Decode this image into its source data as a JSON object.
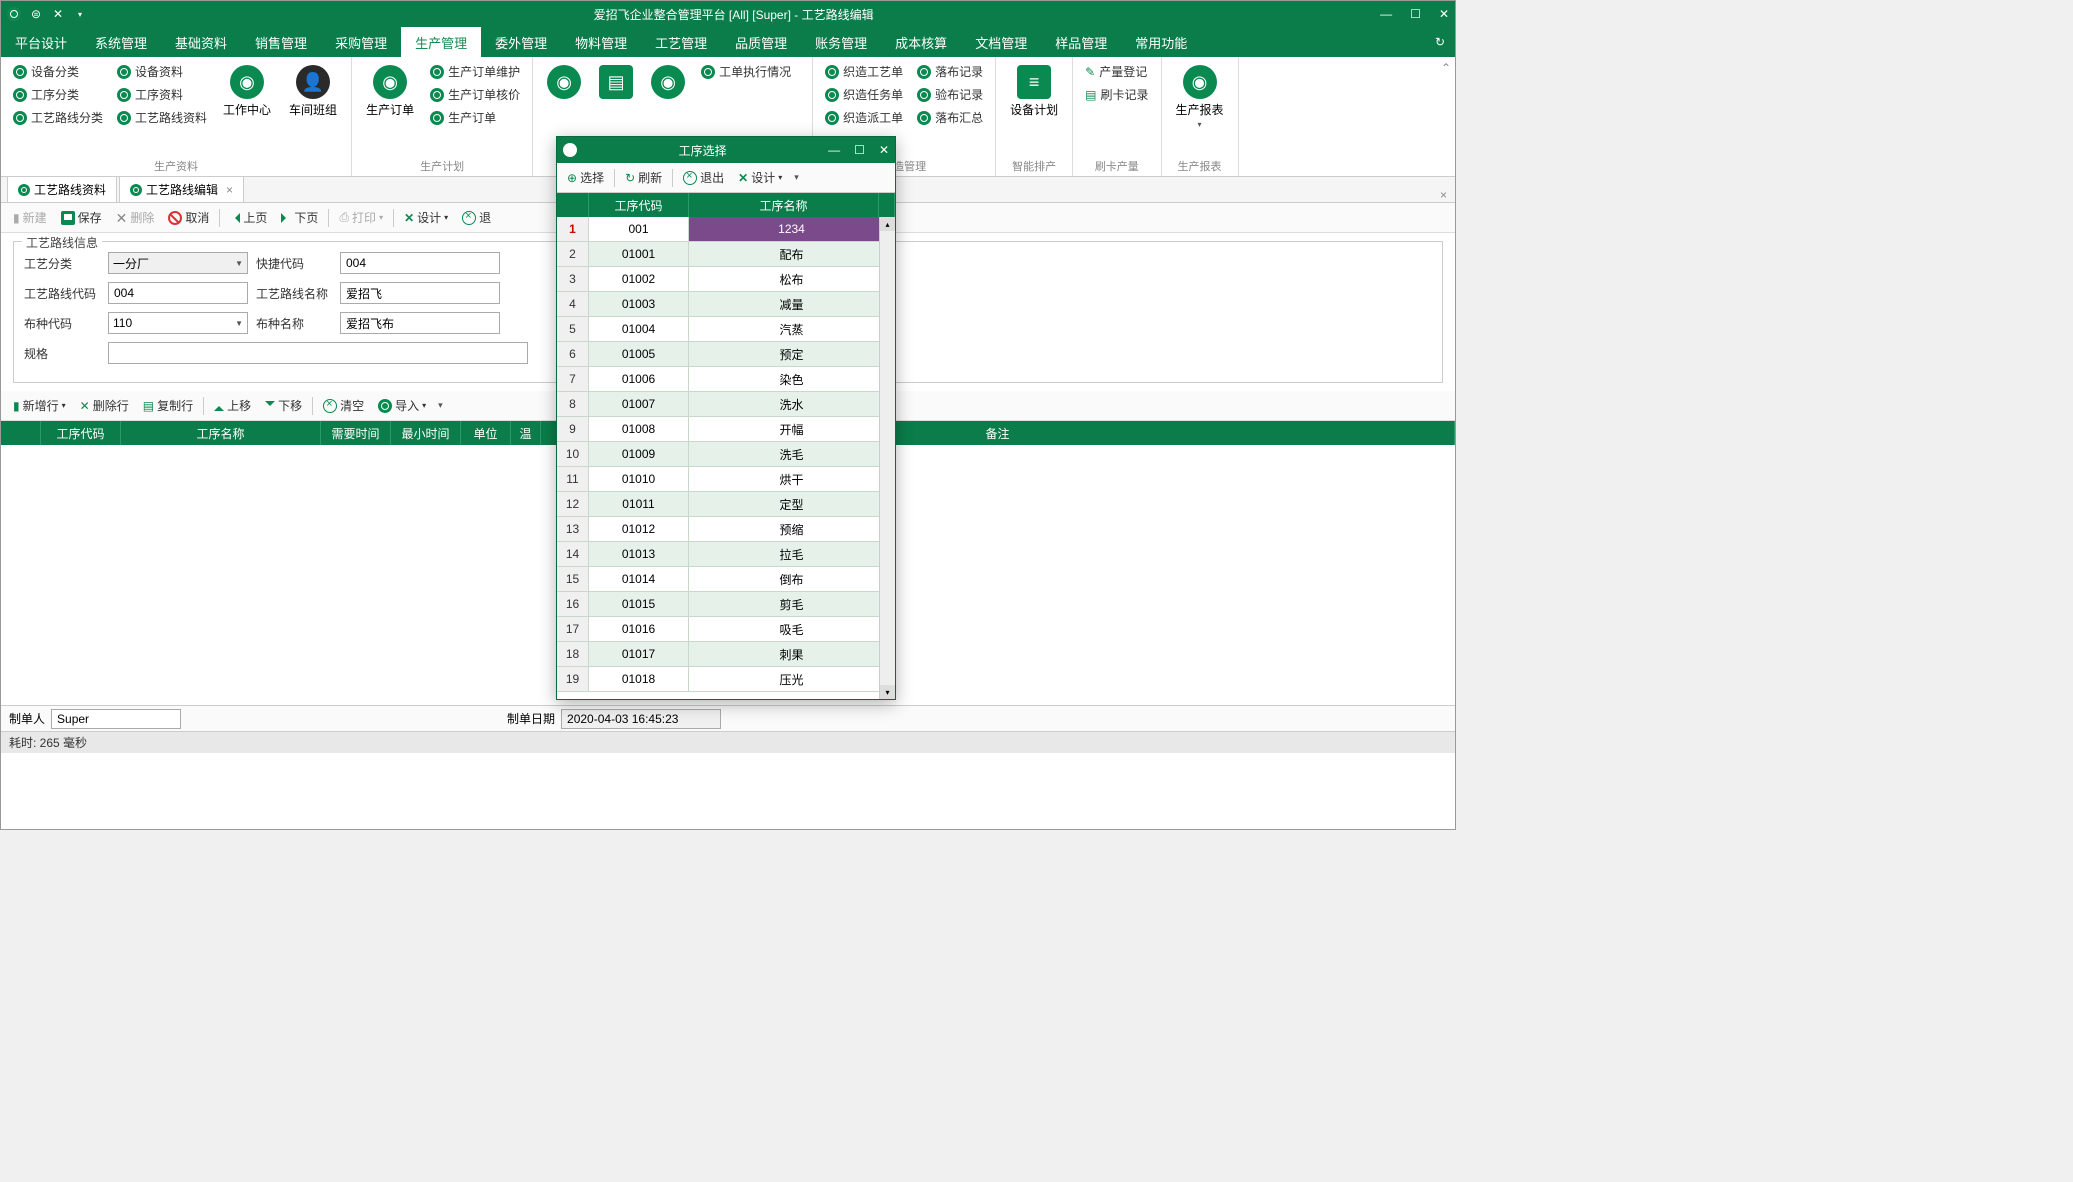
{
  "titlebar": {
    "title": "爱招飞企业整合管理平台 [All] [Super] - 工艺路线编辑"
  },
  "menu": [
    "平台设计",
    "系统管理",
    "基础资料",
    "销售管理",
    "采购管理",
    "生产管理",
    "委外管理",
    "物料管理",
    "工艺管理",
    "品质管理",
    "账务管理",
    "成本核算",
    "文档管理",
    "样品管理",
    "常用功能"
  ],
  "menu_active": 5,
  "ribbon": {
    "g1_label": "生产资料",
    "g1_col1": [
      "设备分类",
      "工序分类",
      "工艺路线分类"
    ],
    "g1_col2": [
      "设备资料",
      "工序资料",
      "工艺路线资料"
    ],
    "g1_big1": "工作中心",
    "g1_big2": "车间班组",
    "g2_label": "生产计划",
    "g2_big": "生产订单",
    "g2_col": [
      "生产订单维护",
      "生产订单核价",
      "生产订单"
    ],
    "g3_item": "工单执行情况",
    "g4_label": "织造管理",
    "g4_col1": [
      "织造工艺单",
      "织造任务单",
      "织造派工单"
    ],
    "g4_col2": [
      "落布记录",
      "验布记录",
      "落布汇总"
    ],
    "g5_label": "智能排产",
    "g5_big": "设备计划",
    "g6_label": "刷卡产量",
    "g6_item1": "产量登记",
    "g6_item2": "刷卡记录",
    "g7_label": "生产报表",
    "g7_big": "生产报表"
  },
  "tabs": [
    {
      "label": "工艺路线资料",
      "closable": false
    },
    {
      "label": "工艺路线编辑",
      "closable": true
    }
  ],
  "toolbar1": {
    "new": "新建",
    "save": "保存",
    "del": "删除",
    "cancel": "取消",
    "prev": "上页",
    "next": "下页",
    "print": "打印",
    "design": "设计",
    "exit": "退"
  },
  "form": {
    "legend": "工艺路线信息",
    "l_category": "工艺分类",
    "v_category": "一分厂",
    "l_shortcode": "快捷代码",
    "v_shortcode": "004",
    "l_routecode": "工艺路线代码",
    "v_routecode": "004",
    "l_routename": "工艺路线名称",
    "v_routename": "爱招飞",
    "l_fabriccode": "布种代码",
    "v_fabriccode": "110",
    "l_fabricname": "布种名称",
    "v_fabricname": "爱招飞布",
    "l_spec": "规格",
    "v_spec": ""
  },
  "toolbar2": {
    "addrow": "新增行",
    "delrow": "删除行",
    "copyrow": "复制行",
    "moveup": "上移",
    "movedown": "下移",
    "clear": "清空",
    "import": "导入"
  },
  "grid_cols": [
    "",
    "工序代码",
    "工序名称",
    "需要时间",
    "最小时间",
    "单位",
    "温",
    "备注"
  ],
  "footer": {
    "l_creator": "制单人",
    "v_creator": "Super",
    "l_date": "制单日期",
    "v_date": "2020-04-03 16:45:23"
  },
  "status": "耗时: 265 毫秒",
  "dialog": {
    "title": "工序选择",
    "tb": {
      "select": "选择",
      "refresh": "刷新",
      "exit": "退出",
      "design": "设计"
    },
    "cols": [
      "工序代码",
      "工序名称"
    ],
    "rows": [
      {
        "n": "1",
        "code": "001",
        "name": "1234",
        "sel": true
      },
      {
        "n": "2",
        "code": "01001",
        "name": "配布"
      },
      {
        "n": "3",
        "code": "01002",
        "name": "松布"
      },
      {
        "n": "4",
        "code": "01003",
        "name": "减量"
      },
      {
        "n": "5",
        "code": "01004",
        "name": "汽蒸"
      },
      {
        "n": "6",
        "code": "01005",
        "name": "预定"
      },
      {
        "n": "7",
        "code": "01006",
        "name": "染色"
      },
      {
        "n": "8",
        "code": "01007",
        "name": "洗水"
      },
      {
        "n": "9",
        "code": "01008",
        "name": "开幅"
      },
      {
        "n": "10",
        "code": "01009",
        "name": "洗毛"
      },
      {
        "n": "11",
        "code": "01010",
        "name": "烘干"
      },
      {
        "n": "12",
        "code": "01011",
        "name": "定型"
      },
      {
        "n": "13",
        "code": "01012",
        "name": "预缩"
      },
      {
        "n": "14",
        "code": "01013",
        "name": "拉毛"
      },
      {
        "n": "15",
        "code": "01014",
        "name": "倒布"
      },
      {
        "n": "16",
        "code": "01015",
        "name": "剪毛"
      },
      {
        "n": "17",
        "code": "01016",
        "name": "吸毛"
      },
      {
        "n": "18",
        "code": "01017",
        "name": "刺果"
      },
      {
        "n": "19",
        "code": "01018",
        "name": "压光"
      }
    ]
  }
}
